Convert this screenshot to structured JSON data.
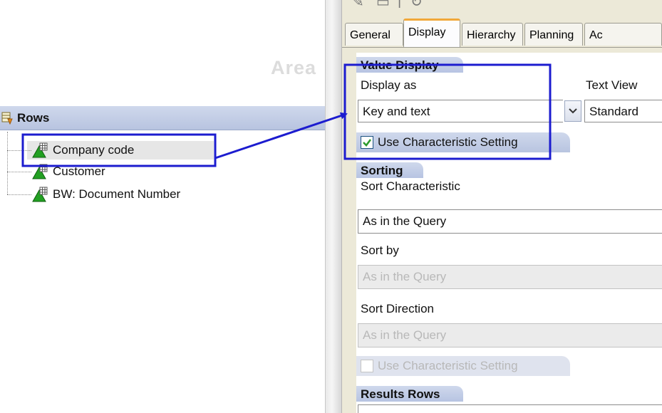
{
  "left_pane": {
    "area_watermark": "Area",
    "rows_header": "Rows",
    "items": [
      {
        "label": "Company code"
      },
      {
        "label": "Customer"
      },
      {
        "label": "BW: Document Number"
      }
    ]
  },
  "tabs": [
    {
      "label": "General"
    },
    {
      "label": "Display"
    },
    {
      "label": "Hierarchy"
    },
    {
      "label": "Planning"
    },
    {
      "label": "Ac"
    }
  ],
  "active_tab": "Display",
  "value_display": {
    "title": "Value Display",
    "display_as_label": "Display as",
    "display_as_value": "Key and text",
    "text_view_label": "Text View",
    "text_view_value": "Standard",
    "use_characteristic_setting": {
      "label": "Use Characteristic Setting",
      "checked": true
    }
  },
  "sorting": {
    "title": "Sorting",
    "sort_characteristic_label": "Sort Characteristic",
    "sort_characteristic_value": "As in the Query",
    "sort_by_label": "Sort by",
    "sort_by_value": "As in the Query",
    "sort_direction_label": "Sort Direction",
    "sort_direction_value": "As in the Query",
    "use_characteristic_setting": {
      "label": "Use Characteristic Setting",
      "checked": false,
      "disabled": true
    }
  },
  "results_rows": {
    "title": "Results Rows"
  },
  "colors": {
    "annotation": "#1c1ccf",
    "group_header": "#c4cfe8",
    "active_tab_accent": "#f1a83a",
    "check_green": "#2e9b2e"
  }
}
